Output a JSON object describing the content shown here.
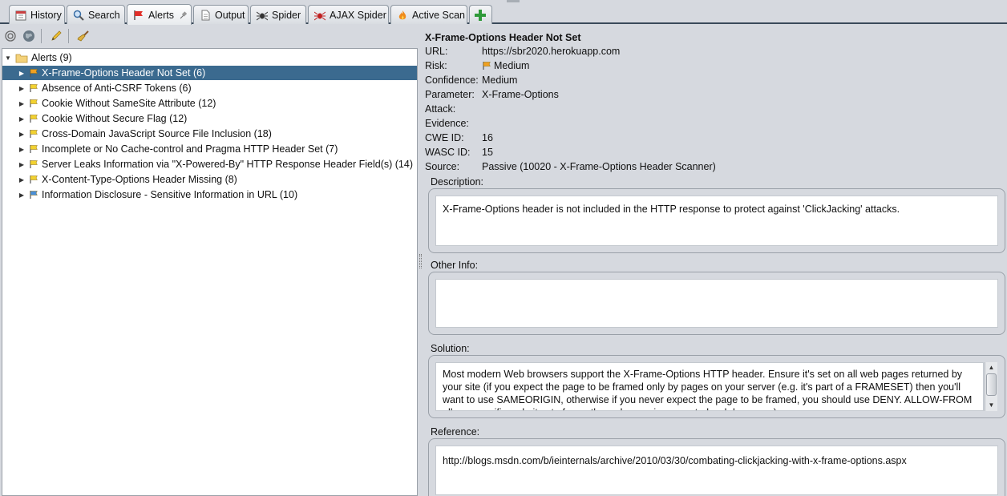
{
  "tabs": [
    {
      "label": "History",
      "icon": "calendar-icon"
    },
    {
      "label": "Search",
      "icon": "magnifier-icon"
    },
    {
      "label": "Alerts",
      "icon": "red-flag-icon",
      "pinned": true
    },
    {
      "label": "Output",
      "icon": "document-icon"
    },
    {
      "label": "Spider",
      "icon": "spider-icon"
    },
    {
      "label": "AJAX Spider",
      "icon": "red-spider-icon"
    },
    {
      "label": "Active Scan",
      "icon": "flame-icon"
    },
    {
      "label": "",
      "icon": "plus-icon"
    }
  ],
  "toolbar": {
    "icons": [
      "filter-circle-icon",
      "globe-icon",
      "pencil-icon",
      "broom-icon"
    ]
  },
  "tree": {
    "root": "Alerts (9)",
    "items": [
      {
        "label": "X-Frame-Options Header Not Set (6)",
        "risk": "medium",
        "selected": true
      },
      {
        "label": "Absence of Anti-CSRF Tokens (6)",
        "risk": "low"
      },
      {
        "label": "Cookie Without SameSite Attribute (12)",
        "risk": "low"
      },
      {
        "label": "Cookie Without Secure Flag (12)",
        "risk": "low"
      },
      {
        "label": "Cross-Domain JavaScript Source File Inclusion (18)",
        "risk": "low"
      },
      {
        "label": "Incomplete or No Cache-control and Pragma HTTP Header Set (7)",
        "risk": "low"
      },
      {
        "label": "Server Leaks Information via \"X-Powered-By\" HTTP Response Header Field(s) (14)",
        "risk": "low"
      },
      {
        "label": "X-Content-Type-Options Header Missing (8)",
        "risk": "low"
      },
      {
        "label": "Information Disclosure - Sensitive Information in URL (10)",
        "risk": "info"
      }
    ]
  },
  "colors": {
    "medium_flag": "#f0a020",
    "low_flag": "#f2d230",
    "info_flag": "#4a8fd8",
    "selection": "#3b6a8f"
  },
  "detail": {
    "title": "X-Frame-Options Header Not Set",
    "fields": [
      {
        "key": "URL:",
        "value": "https://sbr2020.herokuapp.com"
      },
      {
        "key": "Risk:",
        "value": "Medium",
        "flag": "medium"
      },
      {
        "key": "Confidence:",
        "value": "Medium"
      },
      {
        "key": "Parameter:",
        "value": "X-Frame-Options"
      },
      {
        "key": "Attack:",
        "value": ""
      },
      {
        "key": "Evidence:",
        "value": ""
      },
      {
        "key": "CWE ID:",
        "value": "16"
      },
      {
        "key": "WASC ID:",
        "value": "15"
      },
      {
        "key": "Source:",
        "value": "Passive (10020 - X-Frame-Options Header Scanner)"
      }
    ],
    "description_label": "Description:",
    "description": "X-Frame-Options header is not included in the HTTP response to protect against 'ClickJacking' attacks.",
    "other_info_label": "Other Info:",
    "other_info": "",
    "solution_label": "Solution:",
    "solution": "Most modern Web browsers support the X-Frame-Options HTTP header. Ensure it's set on all web pages returned by your site (if you expect the page to be framed only by pages on your server (e.g. it's part of a FRAMESET) then you'll want to use SAMEORIGIN, otherwise if you never expect the page to be framed, you should use DENY. ALLOW-FROM allows specific websites to frame the web page in supported web browsers).",
    "reference_label": "Reference:",
    "reference": "http://blogs.msdn.com/b/ieinternals/archive/2010/03/30/combating-clickjacking-with-x-frame-options.aspx"
  }
}
